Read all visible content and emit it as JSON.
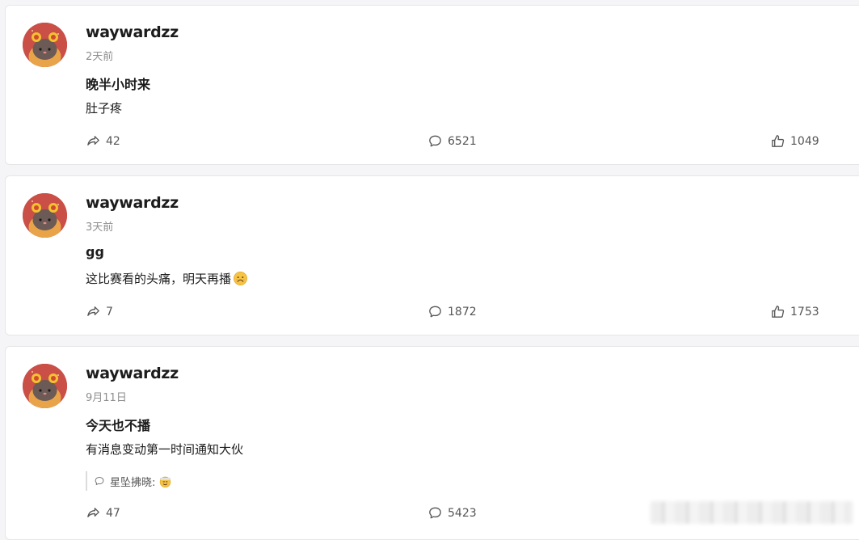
{
  "posts": [
    {
      "author": "waywardzz",
      "time": "2天前",
      "title": "晚半小时来",
      "body": "肚子疼",
      "emoji": "",
      "reposts": "42",
      "comments": "6521",
      "likes": "1049"
    },
    {
      "author": "waywardzz",
      "time": "3天前",
      "title": "gg",
      "body": "这比赛看的头痛，明天再播",
      "emoji": "sad-face",
      "reposts": "7",
      "comments": "1872",
      "likes": "1753"
    },
    {
      "author": "waywardzz",
      "time": "9月11日",
      "title": "今天也不播",
      "body": "有消息变动第一时间通知大伙",
      "quote": {
        "icon": "comment-icon",
        "text": "星坠拂晓:",
        "emoji": "salute-face"
      },
      "reposts": "47",
      "comments": "5423",
      "likes": ""
    }
  ],
  "icons": {
    "repost": "repost-icon",
    "comment": "comment-icon",
    "like": "thumbs-up-icon"
  },
  "colors": {
    "card_bg": "#ffffff",
    "page_bg": "#f5f5f7",
    "avatar_bg": "#c94f47",
    "muted_text": "#8e8e8e"
  }
}
